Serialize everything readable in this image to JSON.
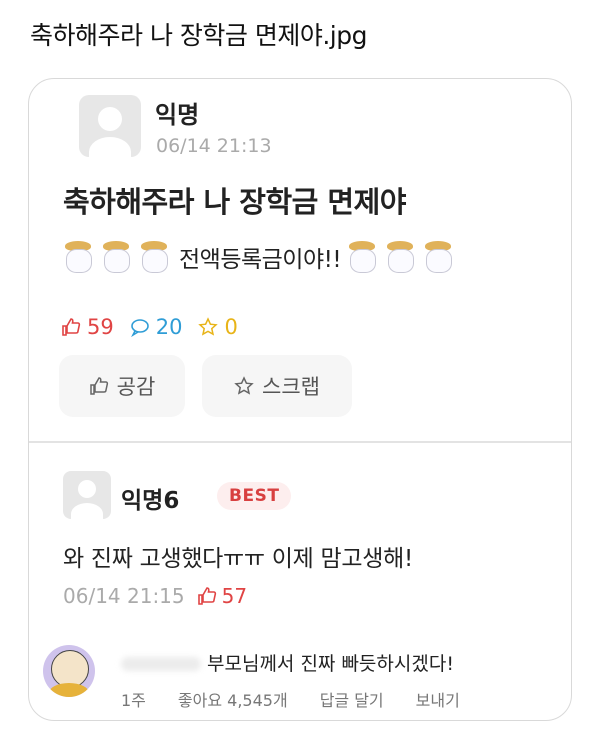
{
  "page_title": "축하해주라 나 장학금 면제야.jpg",
  "post": {
    "author": "익명",
    "time": "06/14 21:13",
    "title": "축하해주라 나 장학금 면제야",
    "body": "전액등록금이야!!",
    "likes": "59",
    "comments": "20",
    "scraps": "0",
    "like_button": "공감",
    "scrap_button": "스크랩"
  },
  "best_comment": {
    "author": "익명6",
    "badge": "BEST",
    "text": "와 진짜 고생했다ㅠㅠ 이제 맘고생해!",
    "time": "06/14 21:15",
    "likes": "57"
  },
  "reply": {
    "text": "부모님께서 진짜 빠듯하시겠다!",
    "age": "1주",
    "likes": "좋아요 4,545개",
    "reply_action": "답글 달기",
    "send_action": "보내기"
  },
  "colors": {
    "accent_red": "#e04444",
    "likes_icon": "#e04444",
    "comment_icon": "#2f9dd6",
    "scrap_icon": "#e8b418"
  }
}
